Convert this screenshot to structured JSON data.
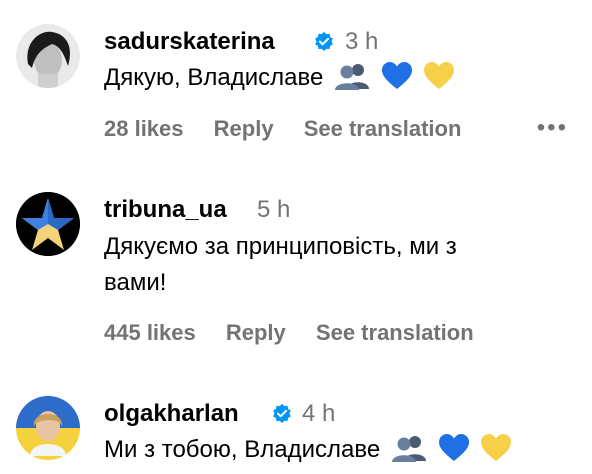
{
  "comments": [
    {
      "username": "sadurskaterina",
      "verified": true,
      "time": "3 h",
      "text": "Дякую, Владиславе",
      "emojis": [
        "busts-in-silhouette",
        "blue-heart",
        "yellow-heart"
      ],
      "likes": "28 likes",
      "reply": "Reply",
      "translate": "See translation",
      "more": "•••"
    },
    {
      "username": "tribuna_ua",
      "verified": false,
      "time": "5 h",
      "text_line1": "Дякуємо за принциповість, ми з",
      "text_line2": "вами!",
      "likes": "445 likes",
      "reply": "Reply",
      "translate": "See translation"
    },
    {
      "username": "olgakharlan",
      "verified": true,
      "time": "4 h",
      "text": "Ми з тобою, Владиславе",
      "emojis": [
        "busts-in-silhouette",
        "blue-heart",
        "yellow-heart"
      ]
    }
  ],
  "colors": {
    "verified": "#0095f6",
    "muted": "#737373",
    "blue_heart": "#1f6fe5",
    "yellow_heart": "#f7d04a"
  }
}
